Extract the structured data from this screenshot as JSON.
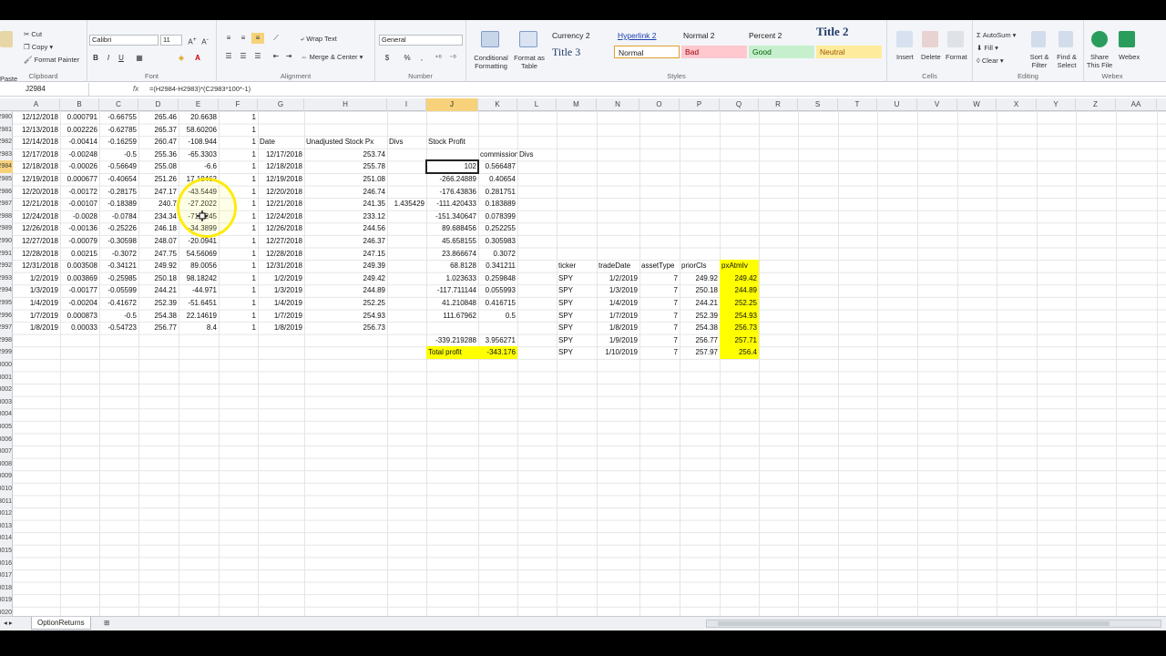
{
  "ribbon": {
    "clipboard": {
      "label": "Clipboard",
      "paste": "Paste",
      "cut": "Cut",
      "copy": "Copy",
      "format_painter": "Format Painter"
    },
    "font": {
      "label": "Font",
      "name": "Calibri",
      "size": "11",
      "bold": "B",
      "italic": "I",
      "underline": "U"
    },
    "alignment": {
      "label": "Alignment",
      "wrap_text": "Wrap Text",
      "merge_center": "Merge & Center"
    },
    "number": {
      "label": "Number",
      "format": "General",
      "currency": "$",
      "percent": "%",
      "comma": ","
    },
    "styles": {
      "label": "Styles",
      "conditional_formatting": "Conditional Formatting",
      "format_as_table": "Format as Table",
      "items": [
        {
          "text": "Currency 2",
          "style": "plain"
        },
        {
          "text": "Hyperlink 2",
          "style": "link"
        },
        {
          "text": "Normal 2",
          "style": "plain"
        },
        {
          "text": "Percent 2",
          "style": "plain"
        },
        {
          "text": "Title 2",
          "style": "title"
        },
        {
          "text": "Title 3",
          "style": "title3"
        },
        {
          "text": "Normal",
          "style": "normal"
        },
        {
          "text": "Bad",
          "style": "bad"
        },
        {
          "text": "Good",
          "style": "good"
        },
        {
          "text": "Neutral",
          "style": "neutral"
        }
      ]
    },
    "cells": {
      "label": "Cells",
      "insert": "Insert",
      "delete": "Delete",
      "format": "Format"
    },
    "editing": {
      "label": "Editing",
      "autosum": "AutoSum",
      "fill": "Fill",
      "clear": "Clear",
      "sort_filter": "Sort & Filter",
      "find_select": "Find & Select"
    },
    "webex": {
      "label": "Webex",
      "share": "Share This File",
      "webex": "Webex"
    }
  },
  "formula_bar": {
    "name_box": "J2984",
    "fx": "fx",
    "formula": "=(H2984-H2983)*(C2983*100*-1)"
  },
  "columns": [
    "A",
    "B",
    "C",
    "D",
    "E",
    "F",
    "G",
    "H",
    "I",
    "J",
    "K",
    "L",
    "M",
    "N",
    "O",
    "P",
    "Q",
    "R",
    "S",
    "T",
    "U",
    "V",
    "W",
    "X",
    "Y",
    "Z",
    "AA"
  ],
  "selected_column": "J",
  "row_numbers": [
    "2980",
    "2981",
    "2982",
    "2983",
    "2984",
    "2985",
    "2986",
    "2987",
    "2988",
    "2989",
    "2990",
    "2991",
    "2992",
    "2993",
    "2994",
    "2995",
    "2996",
    "2997",
    "2998",
    "2999",
    "3000",
    "3001",
    "3002",
    "3003",
    "3004",
    "3005",
    "3006",
    "3007",
    "3008",
    "3009",
    "3010",
    "3011",
    "3012",
    "3013",
    "3014",
    "3015",
    "3016",
    "3017",
    "3018",
    "3019",
    "3020"
  ],
  "selected_row": "2984",
  "rows": [
    {
      "A": "12/12/2018",
      "B": "0.000791",
      "C": "-0.66755",
      "D": "265.46",
      "E": "20.6638",
      "F": "1"
    },
    {
      "A": "12/13/2018",
      "B": "0.002226",
      "C": "-0.62785",
      "D": "265.37",
      "E": "58.60206",
      "F": "1"
    },
    {
      "A": "12/14/2018",
      "B": "-0.00414",
      "C": "-0.16259",
      "D": "260.47",
      "E": "-108.944",
      "F": "1",
      "G": "Date",
      "H": "Unadjusted Stock Px",
      "I": "Divs",
      "J": "Stock Profit"
    },
    {
      "A": "12/17/2018",
      "B": "-0.00248",
      "C": "-0.5",
      "D": "255.36",
      "E": "-65.3303",
      "F": "1",
      "G": "12/17/2018",
      "H": "253.74",
      "K": "commissions",
      "L": "Divs"
    },
    {
      "A": "12/18/2018",
      "B": "-0.00026",
      "C": "-0.56649",
      "D": "255.08",
      "E": "-6.6",
      "F": "1",
      "G": "12/18/2018",
      "H": "255.78",
      "J": "102",
      "K": "0.566487"
    },
    {
      "A": "12/19/2018",
      "B": "0.000677",
      "C": "-0.40654",
      "D": "251.26",
      "E": "17.18462",
      "F": "1",
      "G": "12/19/2018",
      "H": "251.08",
      "J": "-266.24889",
      "K": "0.40654"
    },
    {
      "A": "12/20/2018",
      "B": "-0.00172",
      "C": "-0.28175",
      "D": "247.17",
      "E": "-43.5449",
      "F": "1",
      "G": "12/20/2018",
      "H": "246.74",
      "J": "-176.43836",
      "K": "0.281751"
    },
    {
      "A": "12/21/2018",
      "B": "-0.00107",
      "C": "-0.18389",
      "D": "240.7",
      "E": "-27.2022",
      "F": "1",
      "G": "12/21/2018",
      "H": "241.35",
      "I": "1.435429",
      "J": "-111.420433",
      "K": "0.183889"
    },
    {
      "A": "12/24/2018",
      "B": "-0.0028",
      "C": "-0.0784",
      "D": "234.34",
      "E": "-71.0245",
      "F": "1",
      "G": "12/24/2018",
      "H": "233.12",
      "J": "-151.340647",
      "K": "0.078399"
    },
    {
      "A": "12/26/2018",
      "B": "-0.00136",
      "C": "-0.25226",
      "D": "246.18",
      "E": "-34.3899",
      "F": "1",
      "G": "12/26/2018",
      "H": "244.56",
      "J": "89.688456",
      "K": "0.252255"
    },
    {
      "A": "12/27/2018",
      "B": "-0.00079",
      "C": "-0.30598",
      "D": "248.07",
      "E": "-20.0941",
      "F": "1",
      "G": "12/27/2018",
      "H": "246.37",
      "J": "45.658155",
      "K": "0.305983"
    },
    {
      "A": "12/28/2018",
      "B": "0.00215",
      "C": "-0.3072",
      "D": "247.75",
      "E": "54.56069",
      "F": "1",
      "G": "12/28/2018",
      "H": "247.15",
      "J": "23.866674",
      "K": "0.3072"
    },
    {
      "A": "12/31/2018",
      "B": "0.003508",
      "C": "-0.34121",
      "D": "249.92",
      "E": "89.0056",
      "F": "1",
      "G": "12/31/2018",
      "H": "249.39",
      "J": "68.8128",
      "K": "0.341211",
      "M": "ticker",
      "N": "tradeDate",
      "O": "assetType",
      "P": "priorCls",
      "Q": "pxAtmIv"
    },
    {
      "A": "1/2/2019",
      "B": "0.003869",
      "C": "-0.25985",
      "D": "250.18",
      "E": "98.18242",
      "F": "1",
      "G": "1/2/2019",
      "H": "249.42",
      "J": "1.023633",
      "K": "0.259848",
      "M": "SPY",
      "N": "1/2/2019",
      "O": "7",
      "P": "249.92",
      "Q": "249.42"
    },
    {
      "A": "1/3/2019",
      "B": "-0.00177",
      "C": "-0.05599",
      "D": "244.21",
      "E": "-44.971",
      "F": "1",
      "G": "1/3/2019",
      "H": "244.89",
      "J": "-117.711144",
      "K": "0.055993",
      "M": "SPY",
      "N": "1/3/2019",
      "O": "7",
      "P": "250.18",
      "Q": "244.89"
    },
    {
      "A": "1/4/2019",
      "B": "-0.00204",
      "C": "-0.41672",
      "D": "252.39",
      "E": "-51.6451",
      "F": "1",
      "G": "1/4/2019",
      "H": "252.25",
      "J": "41.210848",
      "K": "0.416715",
      "M": "SPY",
      "N": "1/4/2019",
      "O": "7",
      "P": "244.21",
      "Q": "252.25"
    },
    {
      "A": "1/7/2019",
      "B": "0.000873",
      "C": "-0.5",
      "D": "254.38",
      "E": "22.14619",
      "F": "1",
      "G": "1/7/2019",
      "H": "254.93",
      "J": "111.67962",
      "K": "0.5",
      "M": "SPY",
      "N": "1/7/2019",
      "O": "7",
      "P": "252.39",
      "Q": "254.93"
    },
    {
      "A": "1/8/2019",
      "B": "0.00033",
      "C": "-0.54723",
      "D": "256.77",
      "E": "8.4",
      "F": "1",
      "G": "1/8/2019",
      "H": "256.73",
      "M": "SPY",
      "N": "1/8/2019",
      "O": "7",
      "P": "254.38",
      "Q": "256.73"
    },
    {
      "J": "-339.219288",
      "K": "3.956271",
      "M": "SPY",
      "N": "1/9/2019",
      "O": "7",
      "P": "256.77",
      "Q": "257.71"
    },
    {
      "J": "Total profit",
      "K": "-343.176",
      "M": "SPY",
      "N": "1/10/2019",
      "O": "7",
      "P": "257.97",
      "Q": "256.4"
    }
  ],
  "sheet_tab": "OptionReturns",
  "colors": {
    "selected_header": "#f7d27a",
    "highlight": "#ffff00",
    "bad": "#ffc7ce",
    "good": "#c6efce",
    "neutral": "#ffeb9c"
  }
}
